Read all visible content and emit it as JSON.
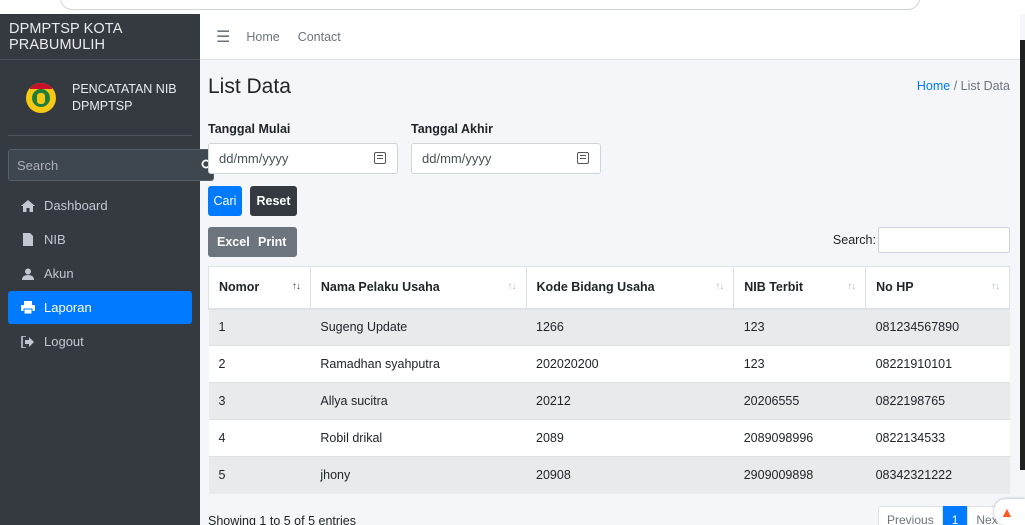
{
  "app": {
    "brand": "DPMPTSP KOTA PRABUMULIH",
    "user_line1": "PENCATATAN NIB",
    "user_line2": "DPMPTSP",
    "search_placeholder": "Search"
  },
  "nav": [
    {
      "label": "Dashboard",
      "icon": "home-icon",
      "active": false
    },
    {
      "label": "NIB",
      "icon": "file-icon",
      "active": false
    },
    {
      "label": "Akun",
      "icon": "user-icon",
      "active": false
    },
    {
      "label": "Laporan",
      "icon": "print-icon",
      "active": true
    },
    {
      "label": "Logout",
      "icon": "logout-icon",
      "active": false
    }
  ],
  "topbar": {
    "home": "Home",
    "contact": "Contact"
  },
  "page": {
    "title": "List Data",
    "breadcrumb_home": "Home",
    "breadcrumb_sep": "/",
    "breadcrumb_current": "List Data"
  },
  "filter": {
    "start_label": "Tanggal Mulai",
    "end_label": "Tanggal Akhir",
    "date_placeholder": "dd/mm/yyyy",
    "cari": "Cari",
    "reset": "Reset"
  },
  "export": {
    "excel": "Excel",
    "print": "Print"
  },
  "table": {
    "search_label": "Search:",
    "columns": [
      "Nomor",
      "Nama Pelaku Usaha",
      "Kode Bidang Usaha",
      "NIB Terbit",
      "No HP"
    ],
    "rows": [
      [
        "1",
        "Sugeng Update",
        "1266",
        "123",
        "081234567890"
      ],
      [
        "2",
        "Ramadhan syahputra",
        "202020200",
        "123",
        "08221910101"
      ],
      [
        "3",
        "Allya sucitra",
        "20212",
        "20206555",
        "0822198765"
      ],
      [
        "4",
        "Robil drikal",
        "2089",
        "2089098996",
        "0822134533"
      ],
      [
        "5",
        "jhony",
        "20908",
        "2909009898",
        "08342321222"
      ]
    ]
  },
  "footer": {
    "showing": "Showing 1 to 5 of 5 entries",
    "previous": "Previous",
    "page": "1",
    "next": "Nex"
  },
  "colors": {
    "accent": "#007bff",
    "sidebar": "#343a40"
  }
}
